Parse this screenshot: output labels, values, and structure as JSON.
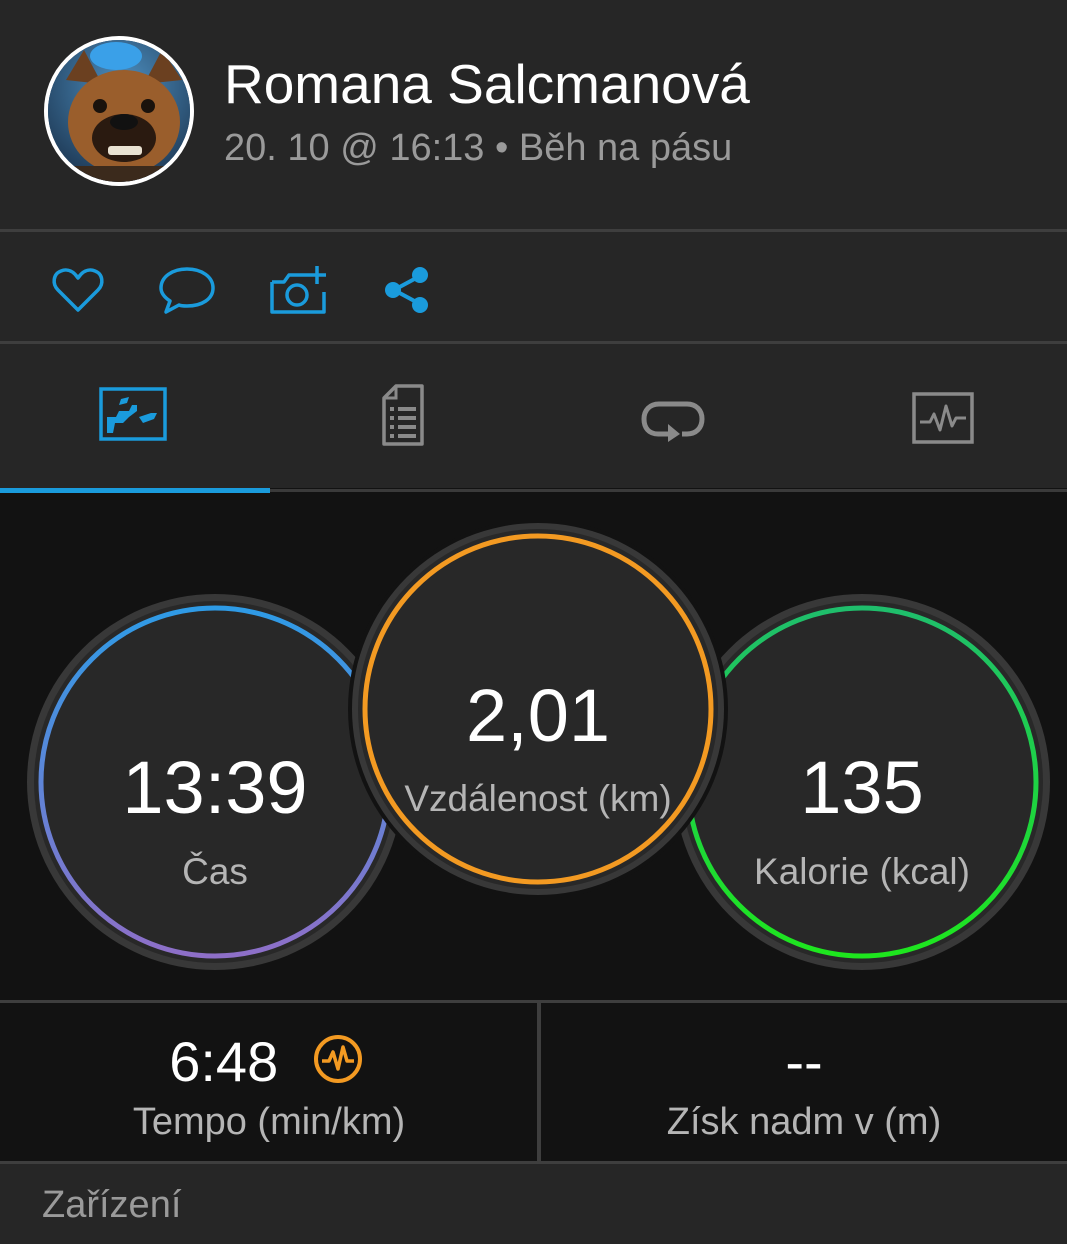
{
  "profile": {
    "name": "Romana Salcmanová",
    "date_time": "20. 10 @ 16:13",
    "separator": "•",
    "activity_type": "Běh na pásu"
  },
  "actions": [
    {
      "name": "like",
      "icon": "heart-icon"
    },
    {
      "name": "comment",
      "icon": "comment-icon"
    },
    {
      "name": "add-photo",
      "icon": "camera-add-icon"
    },
    {
      "name": "share",
      "icon": "share-icon"
    }
  ],
  "tabs": [
    {
      "name": "overview",
      "icon": "overview-chart-icon",
      "active": true
    },
    {
      "name": "details",
      "icon": "document-list-icon",
      "active": false
    },
    {
      "name": "laps",
      "icon": "laps-loop-icon",
      "active": false
    },
    {
      "name": "charts",
      "icon": "heart-rate-graph-icon",
      "active": false
    }
  ],
  "stats": {
    "time": {
      "value": "13:39",
      "label": "Čas"
    },
    "distance": {
      "value": "2,01",
      "label": "Vzdálenost (km)"
    },
    "calories": {
      "value": "135",
      "label": "Kalorie (kcal)"
    }
  },
  "summary": {
    "pace": {
      "value": "6:48",
      "label": "Tempo (min/km)",
      "icon": "pace-pulse-icon"
    },
    "elevation": {
      "value": "--",
      "label": "Získ nadm v (m)"
    }
  },
  "footer": {
    "label": "Zařízení"
  },
  "colors": {
    "accent": "#1a9bdc",
    "time_ring_start": "#2e9be6",
    "time_ring_end": "#8e6fc8",
    "distance_ring": "#f39a22",
    "calories_ring_start": "#1fbe6c",
    "calories_ring_end": "#1ee61e",
    "pace_icon": "#f39a22"
  }
}
